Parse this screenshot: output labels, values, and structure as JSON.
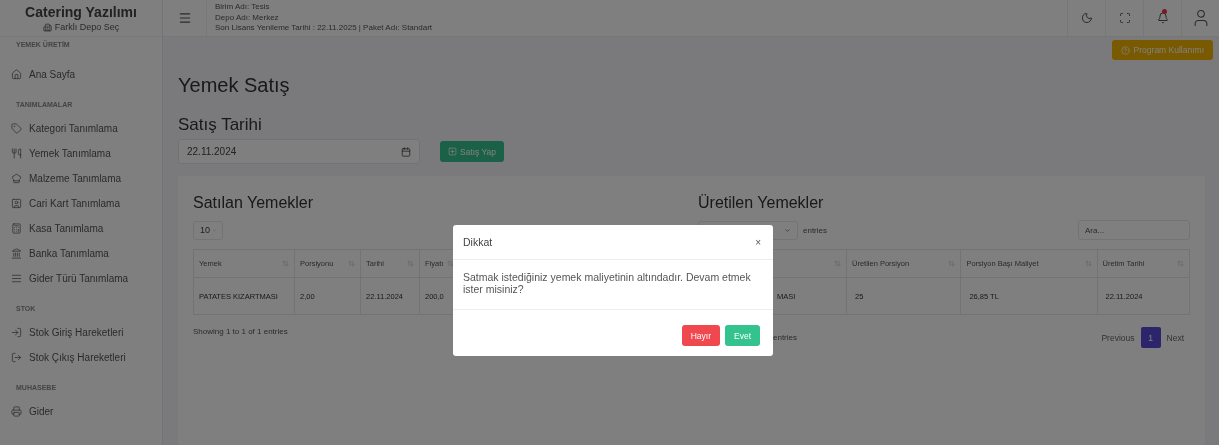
{
  "sidebar": {
    "title": "Catering Yazılımı",
    "depot_link": "Farklı Depo Seç",
    "sections": [
      {
        "heading": "YEMEK ÜRETİM",
        "items": [
          {
            "label": "Ana Sayfa"
          }
        ]
      },
      {
        "heading": "TANIMLAMALAR",
        "items": [
          {
            "label": "Kategori Tanımlama"
          },
          {
            "label": "Yemek Tanımlama"
          },
          {
            "label": "Malzeme Tanımlama"
          },
          {
            "label": "Cari Kart Tanımlama"
          },
          {
            "label": "Kasa Tanımlama"
          },
          {
            "label": "Banka Tanımlama"
          },
          {
            "label": "Gider Türü Tanımlama"
          }
        ]
      },
      {
        "heading": "STOK",
        "items": [
          {
            "label": "Stok Giriş Hareketleri"
          },
          {
            "label": "Stok Çıkış Hareketleri"
          }
        ]
      },
      {
        "heading": "MUHASEBE",
        "items": [
          {
            "label": "Gider"
          }
        ]
      }
    ]
  },
  "header": {
    "lines": [
      "Birim Adı: Tesis",
      "Depo Adı: Merkez",
      "Son Lisans Yenileme Tarihi : 22.11.2025 | Paket Adı: Standart"
    ],
    "has_notification": true
  },
  "help_button": "Program Kullanımı",
  "page_title": "Yemek Satış",
  "sale_date": {
    "label": "Satış Tarihi",
    "value": "22.11.2024",
    "button": "Satış Yap"
  },
  "sold_table": {
    "title": "Satılan Yemekler",
    "page_length": "10",
    "columns": [
      "Yemek",
      "Porsiyonu",
      "Tarihi",
      "Fiyatı"
    ],
    "rows": [
      [
        "PATATES KIZARTMASI",
        "2,00",
        "22.11.2024",
        "200,0"
      ]
    ],
    "info": "Showing 1 to 1 of 1 entries"
  },
  "produced_table": {
    "title": "Üretilen Yemekler",
    "entries_label": "entries",
    "search": {
      "placeholder": "Ara..."
    },
    "columns": [
      "",
      "Üretilen Porsiyon",
      "Porsiyon Başı Maliyet",
      "Üretim Tarihi"
    ],
    "rows": [
      [
        "MASI",
        "25",
        "26,85 TL",
        "22.11.2024"
      ]
    ],
    "info": "entries",
    "previous": "Previous",
    "pages": [
      {
        "label": "1",
        "selected": true
      }
    ],
    "next": "Next"
  },
  "dialog": {
    "title": "Dikkat",
    "close": "×",
    "message": "Satmak istediğiniz yemek maliyetinin altındadır. Devam etmek ister misiniz?",
    "buttons": [
      {
        "label": "Hayır",
        "kind": "danger"
      },
      {
        "label": "Evet",
        "kind": "success"
      }
    ]
  }
}
